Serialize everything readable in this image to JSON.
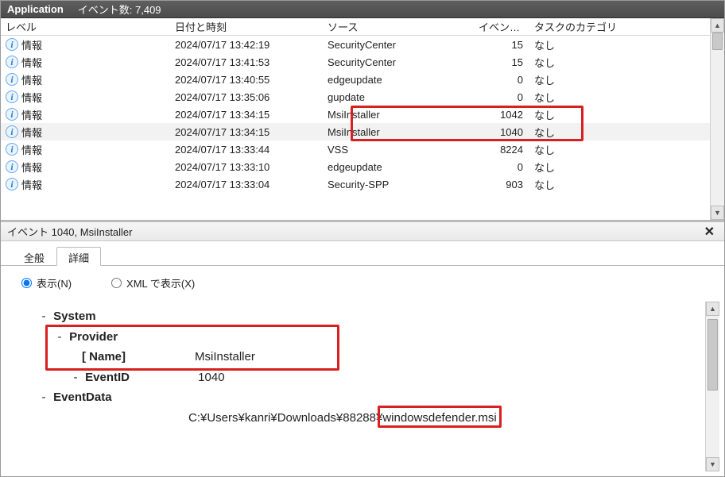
{
  "titlebar": {
    "log_name": "Application",
    "count_label": "イベント数: 7,409"
  },
  "columns": {
    "level": "レベル",
    "datetime": "日付と時刻",
    "source": "ソース",
    "event_id": "イベント ID",
    "task": "タスクのカテゴリ"
  },
  "level_info_label": "情報",
  "rows": [
    {
      "datetime": "2024/07/17 13:42:19",
      "source": "SecurityCenter",
      "event_id": "15",
      "task": "なし",
      "selected": false
    },
    {
      "datetime": "2024/07/17 13:41:53",
      "source": "SecurityCenter",
      "event_id": "15",
      "task": "なし",
      "selected": false
    },
    {
      "datetime": "2024/07/17 13:40:55",
      "source": "edgeupdate",
      "event_id": "0",
      "task": "なし",
      "selected": false
    },
    {
      "datetime": "2024/07/17 13:35:06",
      "source": "gupdate",
      "event_id": "0",
      "task": "なし",
      "selected": false
    },
    {
      "datetime": "2024/07/17 13:34:15",
      "source": "MsiInstaller",
      "event_id": "1042",
      "task": "なし",
      "selected": false
    },
    {
      "datetime": "2024/07/17 13:34:15",
      "source": "MsiInstaller",
      "event_id": "1040",
      "task": "なし",
      "selected": true
    },
    {
      "datetime": "2024/07/17 13:33:44",
      "source": "VSS",
      "event_id": "8224",
      "task": "なし",
      "selected": false
    },
    {
      "datetime": "2024/07/17 13:33:10",
      "source": "edgeupdate",
      "event_id": "0",
      "task": "なし",
      "selected": false
    },
    {
      "datetime": "2024/07/17 13:33:04",
      "source": "Security-SPP",
      "event_id": "903",
      "task": "なし",
      "selected": false
    }
  ],
  "detail_header": {
    "title": "イベント 1040, MsiInstaller",
    "close": "✕"
  },
  "tabs": {
    "general": "全般",
    "details": "詳細"
  },
  "view_radios": {
    "friendly": "表示(N)",
    "xml": "XML で表示(X)"
  },
  "tree": {
    "system": "System",
    "provider": "Provider",
    "provider_name_key": "[ Name]",
    "provider_name_val": "MsiInstaller",
    "eventid_key": "EventID",
    "eventid_val": "1040",
    "eventdata": "EventData",
    "path_prefix": "C:¥Users¥kanri¥Downloads¥88288¥",
    "path_file": "windowsdefender.msi"
  }
}
